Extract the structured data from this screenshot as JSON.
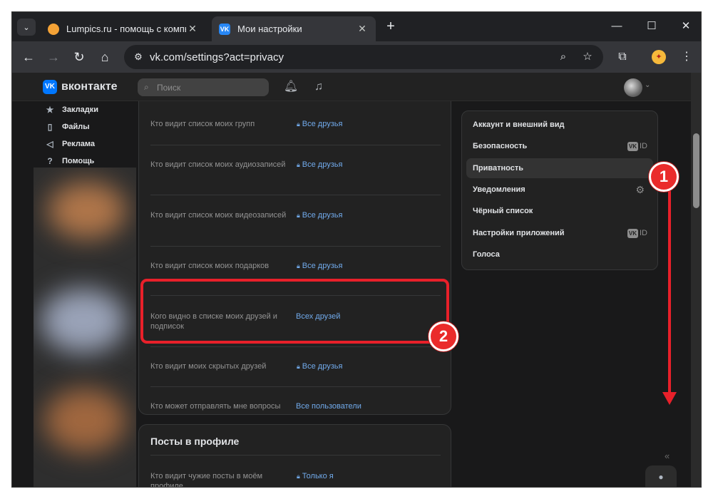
{
  "browser": {
    "tabs": [
      {
        "title": "Lumpics.ru - помощь с компь",
        "active": false
      },
      {
        "title": "Мои настройки",
        "active": true
      }
    ],
    "url": "vk.com/settings?act=privacy",
    "icons": {
      "tab_list": "chevron-down-icon",
      "close": "close-icon",
      "new_tab": "plus-icon",
      "minimize": "minimize-icon",
      "maximize": "maximize-icon",
      "window_close": "window-close-icon"
    }
  },
  "vk": {
    "brand": "вконтакте",
    "search_placeholder": "Поиск",
    "left_menu": [
      {
        "icon": "bookmark-icon",
        "label": "Закладки"
      },
      {
        "icon": "file-icon",
        "label": "Файлы"
      },
      {
        "icon": "megaphone-icon",
        "label": "Реклама"
      },
      {
        "icon": "help-icon",
        "label": "Помощь"
      }
    ],
    "privacy_rows": [
      {
        "label": "Кто видит список моих групп",
        "value": "Все друзья",
        "lock": true
      },
      {
        "label": "Кто видит список моих аудиозаписей",
        "value": "Все друзья",
        "lock": true
      },
      {
        "label": "Кто видит список моих видеозаписей",
        "value": "Все друзья",
        "lock": true
      },
      {
        "label": "Кто видит список моих подарков",
        "value": "Все друзья",
        "lock": true
      },
      {
        "label": "Кого видно в списке моих друзей и подписок",
        "value": "Всех друзей",
        "lock": false
      },
      {
        "label": "Кто видит моих скрытых друзей",
        "value": "Все друзья",
        "lock": true
      },
      {
        "label": "Кто может отправлять мне вопросы",
        "value": "Все пользователи",
        "lock": false
      }
    ],
    "posts_section": {
      "title": "Посты в профиле",
      "row": {
        "label": "Кто видит чужие посты в моём профиле",
        "value": "Только я",
        "lock": true
      }
    },
    "right_menu": [
      {
        "label": "Аккаунт и внешний вид",
        "active": false
      },
      {
        "label": "Безопасность",
        "badge": "ID",
        "active": false
      },
      {
        "label": "Приватность",
        "active": true
      },
      {
        "label": "Уведомления",
        "icon": "gear-icon",
        "active": false
      },
      {
        "label": "Чёрный список",
        "active": false
      },
      {
        "label": "Настройки приложений",
        "badge": "ID",
        "active": false
      },
      {
        "label": "Голоса",
        "active": false
      }
    ],
    "badge_logo": "VK"
  },
  "annotations": {
    "marker1": "1",
    "marker2": "2",
    "color": "#e8202a"
  }
}
